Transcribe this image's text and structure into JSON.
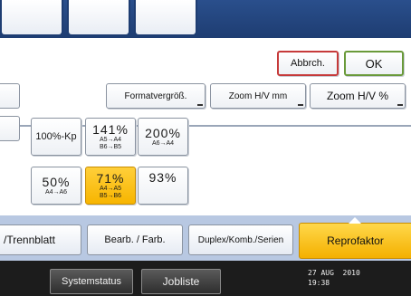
{
  "dialog": {
    "cancel_label": "Abbrch.",
    "ok_label": "OK"
  },
  "mode_buttons": {
    "format_label": "Formatvergröß.",
    "zoom_mm_label": "Zoom H/V mm",
    "zoom_pct_label": "Zoom H/V %"
  },
  "presets": [
    {
      "pct": "100%-Kp",
      "sub": "",
      "selected": false
    },
    {
      "pct": "141%",
      "sub": "A5→A4\nB6→B5",
      "selected": false
    },
    {
      "pct": "200%",
      "sub": "A6→A4",
      "selected": false
    },
    {
      "pct": "50%",
      "sub": "A4→A6",
      "selected": false
    },
    {
      "pct": "71%",
      "sub": "A4→A5\nB5→B6",
      "selected": true
    },
    {
      "pct": "93%",
      "sub": "",
      "selected": false
    }
  ],
  "tabs": {
    "trennblatt": "/Trennblatt",
    "bearb": "Bearb. / Farb.",
    "duplex": "Duplex/Komb./Serien",
    "repro": "Reprofaktor"
  },
  "status": {
    "systemstatus_label": "Systemstatus",
    "jobliste_label": "Jobliste",
    "date": "27 AUG  2010",
    "time": "19:38"
  },
  "colors": {
    "selected": "#f7b500",
    "cancel_border": "#c63a3a",
    "ok_border": "#6a9a3a",
    "header_blue": "#1e3d72"
  }
}
